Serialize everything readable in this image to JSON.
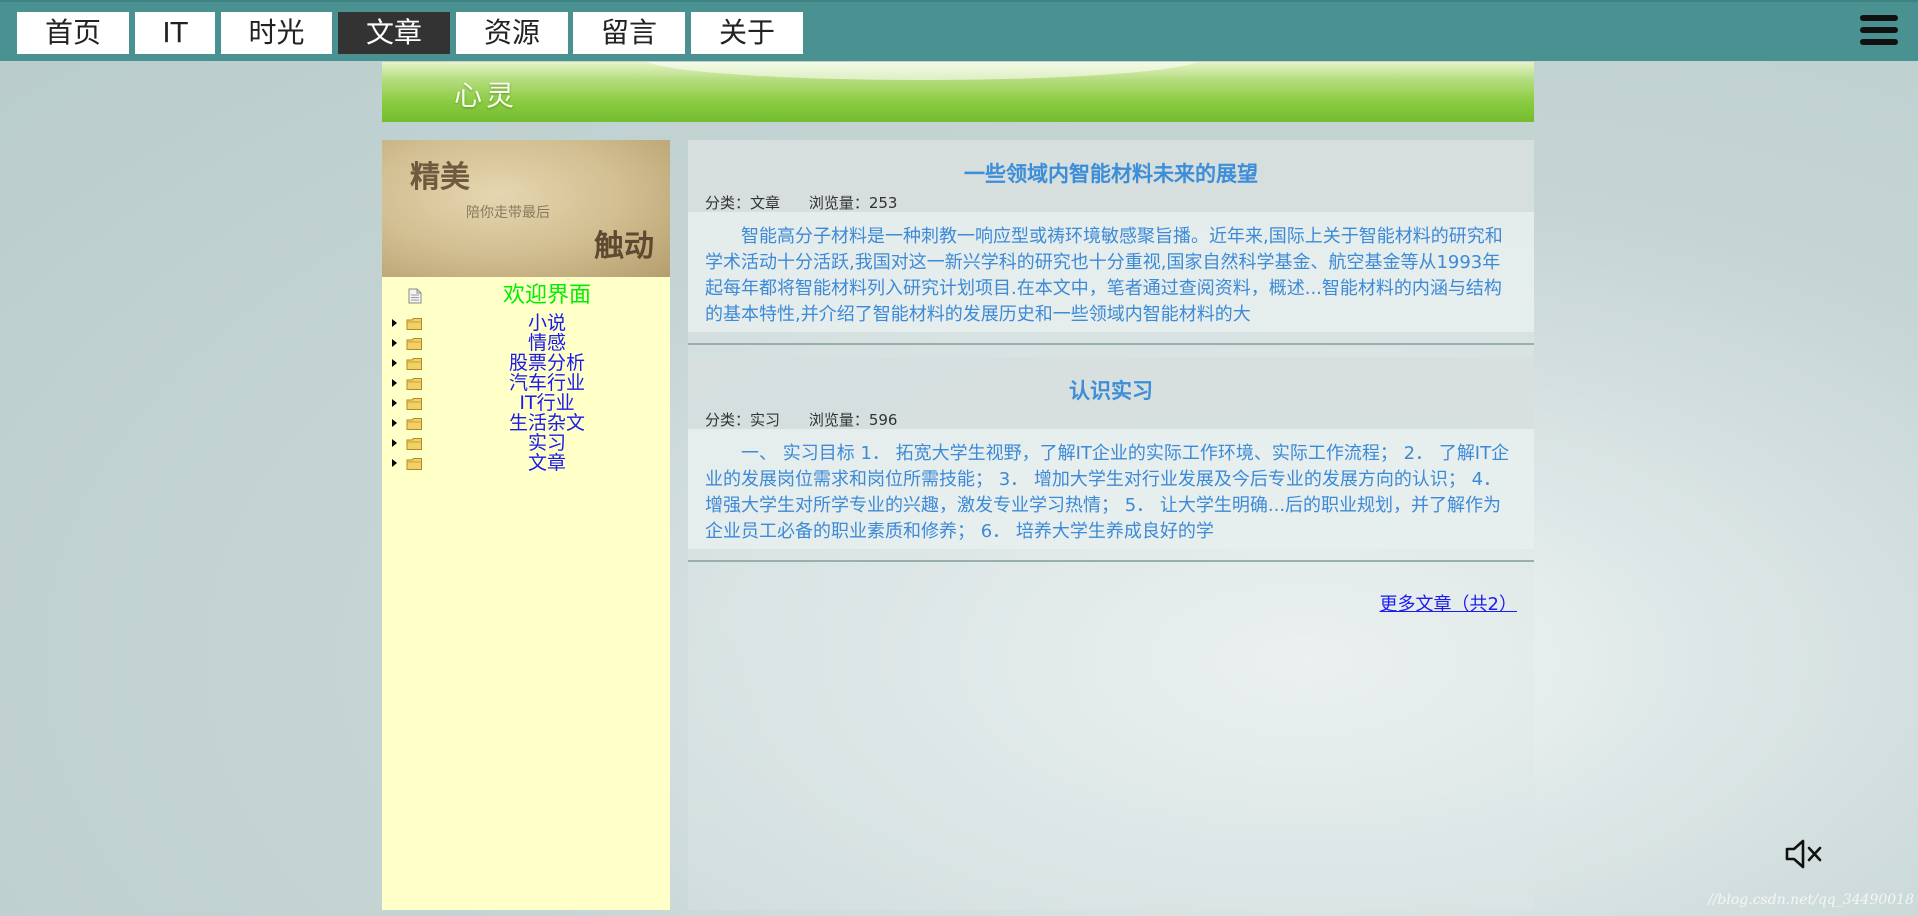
{
  "nav": {
    "items": [
      {
        "label": "首页",
        "active": false
      },
      {
        "label": "IT",
        "active": false
      },
      {
        "label": "时光",
        "active": false
      },
      {
        "label": "文章",
        "active": true
      },
      {
        "label": "资源",
        "active": false
      },
      {
        "label": "留言",
        "active": false
      },
      {
        "label": "关于",
        "active": false
      }
    ],
    "menu_icon": "hamburger-menu-icon"
  },
  "banner": {
    "title": "心灵"
  },
  "sidebar": {
    "header": {
      "text_top_left": "精美",
      "text_middle": "陪你走带最后",
      "text_bottom_right": "触动"
    },
    "root": {
      "label": "欢迎界面",
      "icon": "document-icon"
    },
    "folders": [
      "小说",
      "情感",
      "股票分析",
      "汽车行业",
      "IT行业",
      "生活杂文",
      "实习",
      "文章"
    ]
  },
  "articles": [
    {
      "title": "一些领域内智能材料未来的展望",
      "category_label": "分类：",
      "category": "文章",
      "views_label": "浏览量：",
      "views": "253",
      "excerpt": "智能高分子材料是一种刺教一响应型或祷环境敏感聚旨播。近年来,国际上关于智能材料的研究和学术活动十分活跃,我国对这一新兴学科的研究也十分重视,国家自然科学基金、航空基金等从1993年起每年都将智能材料列入研究计划项目.在本文中，笔者通过查阅资料，概述...智能材料的内涵与结构的基本特性,并介绍了智能材料的发展历史和一些领域内智能材料的大"
    },
    {
      "title": "认识实习",
      "category_label": "分类：",
      "category": "实习",
      "views_label": "浏览量：",
      "views": "596",
      "excerpt": "一、 实习目标 1． 拓宽大学生视野，了解IT企业的实际工作环境、实际工作流程； 2． 了解IT企业的发展岗位需求和岗位所需技能； 3． 增加大学生对行业发展及今后专业的发展方向的认识； 4． 增强大学生对所学专业的兴趣，激发专业学习热情； 5． 让大学生明确...后的职业规划，并了解作为企业员工必备的职业素质和修养； 6． 培养大学生养成良好的学"
    }
  ],
  "more_link": "更多文章（共2）",
  "speaker_icon": "speaker-muted-icon",
  "watermark": "//blog.csdn.net/qq_34490018",
  "colors": {
    "topbar": "#4a9191",
    "sidebar_bg": "#ffffc8",
    "root_label": "#00ee00",
    "folder_label": "#1a1aee",
    "article_title": "#3c8ed8",
    "excerpt": "#3d8ad6"
  }
}
